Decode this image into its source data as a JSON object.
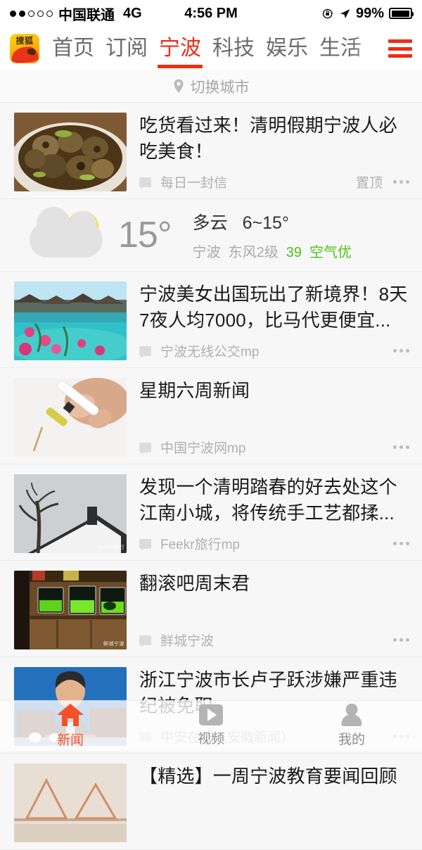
{
  "status_bar": {
    "signal_dots_total": 5,
    "signal_dots_filled": 2,
    "carrier": "中国联通",
    "network": "4G",
    "time": "4:56 PM",
    "battery_percent": "99%",
    "icons": [
      "rotation-lock-icon",
      "location-arrow-icon",
      "battery-icon"
    ]
  },
  "nav": {
    "logo_text": "搜狐",
    "tabs": [
      {
        "label": "首页",
        "active": false
      },
      {
        "label": "订阅",
        "active": false
      },
      {
        "label": "宁波",
        "active": true
      },
      {
        "label": "科技",
        "active": false
      },
      {
        "label": "娱乐",
        "active": false
      },
      {
        "label": "生活",
        "active": false
      }
    ],
    "menu_icon": "hamburger-menu-icon",
    "active_color": "#f12c12"
  },
  "city_switcher": {
    "icon": "location-pin-icon",
    "label": "切换城市"
  },
  "weather": {
    "icon": "partly-cloudy-icon",
    "temperature": "15°",
    "condition": "多云",
    "range": "6~15°",
    "city": "宁波",
    "wind": "东风2级",
    "aqi_value": "39",
    "aqi_label": "空气优",
    "aqi_color": "#4cc417"
  },
  "feed": {
    "items": [
      {
        "title": "吃货看过来！清明假期宁波人必吃美食！",
        "source": "每日一封信",
        "badge": "置顶",
        "thumb": "snails-food-photo",
        "watermark": ""
      },
      {
        "title": "宁波美女出国玩出了新境界！8天7夜人均7000，比马代更便宜...",
        "source": "宁波无线公交mp",
        "badge": "",
        "thumb": "overwater-villas-photo",
        "watermark": ""
      },
      {
        "title": "星期六周新闻",
        "source": "中国宁波网mp",
        "badge": "",
        "thumb": "syringe-photo",
        "watermark": ""
      },
      {
        "title": "发现一个清明踏春的好去处这个江南小城，将传统手工艺都揉...",
        "source": "Feekr旅行mp",
        "badge": "",
        "thumb": "tree-roof-photo",
        "watermark": "Feekr旅行"
      },
      {
        "title": "翻滚吧周末君",
        "source": "鲜城宁波",
        "badge": "",
        "thumb": "aquarium-store-photo",
        "watermark": "鲜城宁波"
      },
      {
        "title": "浙江宁波市长卢子跃涉嫌严重违纪被免职",
        "source": "中安在线（安徽新闻）",
        "badge": "",
        "thumb": "official-press-photo",
        "watermark": ""
      }
    ],
    "partial_item": {
      "title": "【精选】一周宁波教育要闻回顾",
      "thumb": "bridge-photo"
    },
    "more_icon": "ellipsis-icon",
    "comment_icon": "comment-icon"
  },
  "tab_bar": {
    "tabs": [
      {
        "label": "新闻",
        "icon": "home-icon",
        "active": true
      },
      {
        "label": "视频",
        "icon": "video-icon",
        "active": false
      },
      {
        "label": "我的",
        "icon": "person-icon",
        "active": false
      }
    ],
    "active_color": "#f4502a"
  }
}
